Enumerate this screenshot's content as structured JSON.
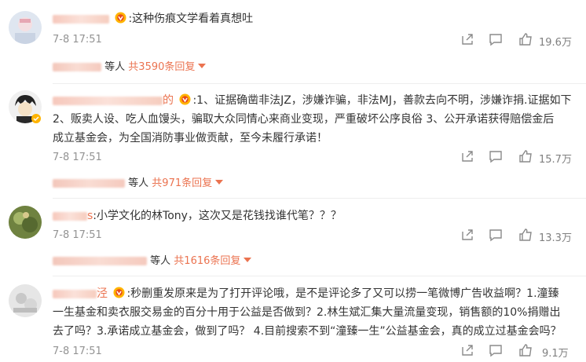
{
  "comments": [
    {
      "lines": [
        "这种伤痕文学看着真想吐"
      ],
      "time": "7-8 17:51",
      "likes": "19.6万",
      "reply_who": "等人",
      "reply_count": "共3590条回复"
    },
    {
      "lines": [
        "1、证据确凿非法JZ，涉嫌诈骗，非法MJ，善款去向不明，涉嫌诈捐.证据如下",
        "2、贩卖人设、吃人血馒头，骗取大众同情心来商业变现，严重破坏公序良俗 3、公开承诺获得赔偿金后",
        "成立基金会，为全国消防事业做贡献，至今未履行承诺！"
      ],
      "time": "7-8 17:51",
      "likes": "15.7万",
      "reply_who": "等人",
      "reply_count": "共971条回复"
    },
    {
      "name_suffix": "s",
      "lines": [
        "小学文化的林Tony，这次又是花钱找谁代笔？？？"
      ],
      "time": "7-8 17:51",
      "likes": "13.3万",
      "reply_who": "等人",
      "reply_count": "共1616条回复"
    },
    {
      "name_suffix": "泾",
      "lines": [
        "秒删重发原来是为了打开评论哦，是不是评论多了又可以捞一笔微博广告收益啊？1.潼臻",
        "一生基金和卖衣服交易金的百分十用于公益是否做到？2.林生斌汇集大量流量变现，销售额的10%捐赠出",
        "去了吗？3.承诺成立基金会，做到了吗？ 4.目前搜索不到“潼臻一生”公益基金会，真的成立过基金会吗？"
      ],
      "time": "7-8 17:51",
      "likes": "9.1万"
    }
  ],
  "colors": {
    "accent": "#eb7350",
    "meta": "#939393",
    "text": "#333333"
  },
  "icons": [
    "share-icon",
    "comment-icon",
    "like-icon",
    "vip-badge-icon",
    "verified-badge-icon"
  ]
}
